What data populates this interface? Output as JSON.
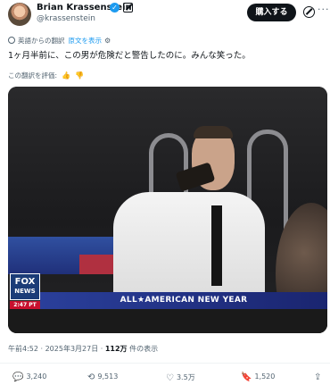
{
  "author": {
    "name": "Brian Krassenstein",
    "handle": "@krassenstein"
  },
  "header": {
    "subscribe_label": "購入する",
    "more_label": "···"
  },
  "translation": {
    "notice": "英語からの翻訳",
    "show_original": "原文を表示",
    "rate_label": "この翻訳を評価:"
  },
  "tweet": {
    "text": "1ヶ月半前に、この男が危険だと警告したのに。みんな笑った。"
  },
  "media": {
    "network_logo_top": "FOX",
    "network_logo_bottom": "NEWS",
    "network_time": "2:47 PT",
    "banner_text": "ALL★AMERICAN NEW YEAR"
  },
  "meta": {
    "timestamp": "午前4:52 · 2025年3月27日 · ",
    "views_count": "112万",
    "views_suffix": " 件の表示"
  },
  "actions": {
    "replies": "3,240",
    "reposts": "9,513",
    "likes": "3.5万",
    "bookmarks": "1,520"
  },
  "colors": {
    "accent": "#1d9bf0",
    "text": "#0f1419",
    "muted": "#536471"
  },
  "icons": [
    "globe-icon",
    "gear-icon",
    "thumb-up-icon",
    "thumb-down-icon",
    "reply-icon",
    "repost-icon",
    "like-icon",
    "bookmark-icon",
    "share-icon",
    "verified-icon",
    "grok-icon",
    "more-icon"
  ]
}
